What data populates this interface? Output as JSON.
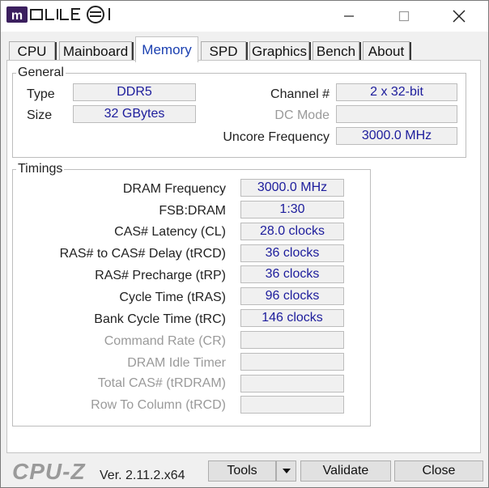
{
  "title_bar": {
    "logo_text": "mobile01",
    "minimize_icon": "minimize-icon",
    "maximize_icon": "maximize-icon",
    "close_icon": "close-icon"
  },
  "tabs": [
    {
      "label": "CPU",
      "active": false
    },
    {
      "label": "Mainboard",
      "active": false
    },
    {
      "label": "Memory",
      "active": true
    },
    {
      "label": "SPD",
      "active": false
    },
    {
      "label": "Graphics",
      "active": false
    },
    {
      "label": "Bench",
      "active": false
    },
    {
      "label": "About",
      "active": false
    }
  ],
  "general": {
    "legend": "General",
    "type_label": "Type",
    "type_value": "DDR5",
    "size_label": "Size",
    "size_value": "32 GBytes",
    "channel_label": "Channel #",
    "channel_value": "2 x 32-bit",
    "dc_mode_label": "DC Mode",
    "dc_mode_value": "",
    "uncore_label": "Uncore Frequency",
    "uncore_value": "3000.0 MHz"
  },
  "timings": {
    "legend": "Timings",
    "rows": [
      {
        "label": "DRAM Frequency",
        "value": "3000.0 MHz",
        "enabled": true
      },
      {
        "label": "FSB:DRAM",
        "value": "1:30",
        "enabled": true
      },
      {
        "label": "CAS# Latency (CL)",
        "value": "28.0 clocks",
        "enabled": true
      },
      {
        "label": "RAS# to CAS# Delay (tRCD)",
        "value": "36 clocks",
        "enabled": true
      },
      {
        "label": "RAS# Precharge (tRP)",
        "value": "36 clocks",
        "enabled": true
      },
      {
        "label": "Cycle Time (tRAS)",
        "value": "96 clocks",
        "enabled": true
      },
      {
        "label": "Bank Cycle Time (tRC)",
        "value": "146 clocks",
        "enabled": true
      },
      {
        "label": "Command Rate (CR)",
        "value": "",
        "enabled": false
      },
      {
        "label": "DRAM Idle Timer",
        "value": "",
        "enabled": false
      },
      {
        "label": "Total CAS# (tRDRAM)",
        "value": "",
        "enabled": false
      },
      {
        "label": "Row To Column (tRCD)",
        "value": "",
        "enabled": false
      }
    ]
  },
  "footer": {
    "brand": "CPU-Z",
    "version": "Ver. 2.11.2.x64",
    "tools_label": "Tools",
    "tools_dropdown_icon": "dropdown-arrow-icon",
    "validate_label": "Validate",
    "close_label": "Close"
  }
}
